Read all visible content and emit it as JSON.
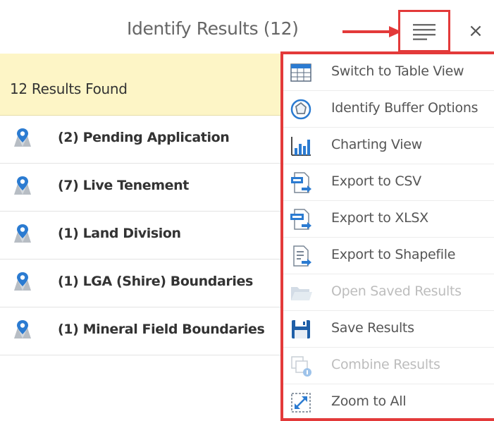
{
  "header": {
    "title": "Identify Results (12)",
    "menu_icon": "hamburger-menu-icon",
    "close_label": "×"
  },
  "results": {
    "summary": "12 Results Found",
    "items": [
      {
        "label": "(2) Pending Application"
      },
      {
        "label": "(7) Live Tenement"
      },
      {
        "label": "(1) Land Division"
      },
      {
        "label": "(1) LGA (Shire) Boundaries"
      },
      {
        "label": "(1) Mineral Field Boundaries"
      }
    ]
  },
  "menu": {
    "items": [
      {
        "label": "Switch to Table View",
        "icon": "table-view-icon",
        "enabled": true
      },
      {
        "label": "Identify Buffer Options",
        "icon": "buffer-icon",
        "enabled": true
      },
      {
        "label": "Charting View",
        "icon": "chart-icon",
        "enabled": true
      },
      {
        "label": "Export to CSV",
        "icon": "export-csv-icon",
        "enabled": true
      },
      {
        "label": "Export to XLSX",
        "icon": "export-xlsx-icon",
        "enabled": true
      },
      {
        "label": "Export to Shapefile",
        "icon": "export-shapefile-icon",
        "enabled": true
      },
      {
        "label": "Open Saved Results",
        "icon": "folder-open-icon",
        "enabled": false
      },
      {
        "label": "Save Results",
        "icon": "save-icon",
        "enabled": true
      },
      {
        "label": "Combine Results",
        "icon": "combine-icon",
        "enabled": false
      },
      {
        "label": "Zoom to All",
        "icon": "zoom-extent-icon",
        "enabled": true
      }
    ]
  },
  "colors": {
    "annotation_red": "#e33a3a",
    "summary_bg": "#fdf5c6",
    "icon_blue": "#2b7bd1"
  }
}
